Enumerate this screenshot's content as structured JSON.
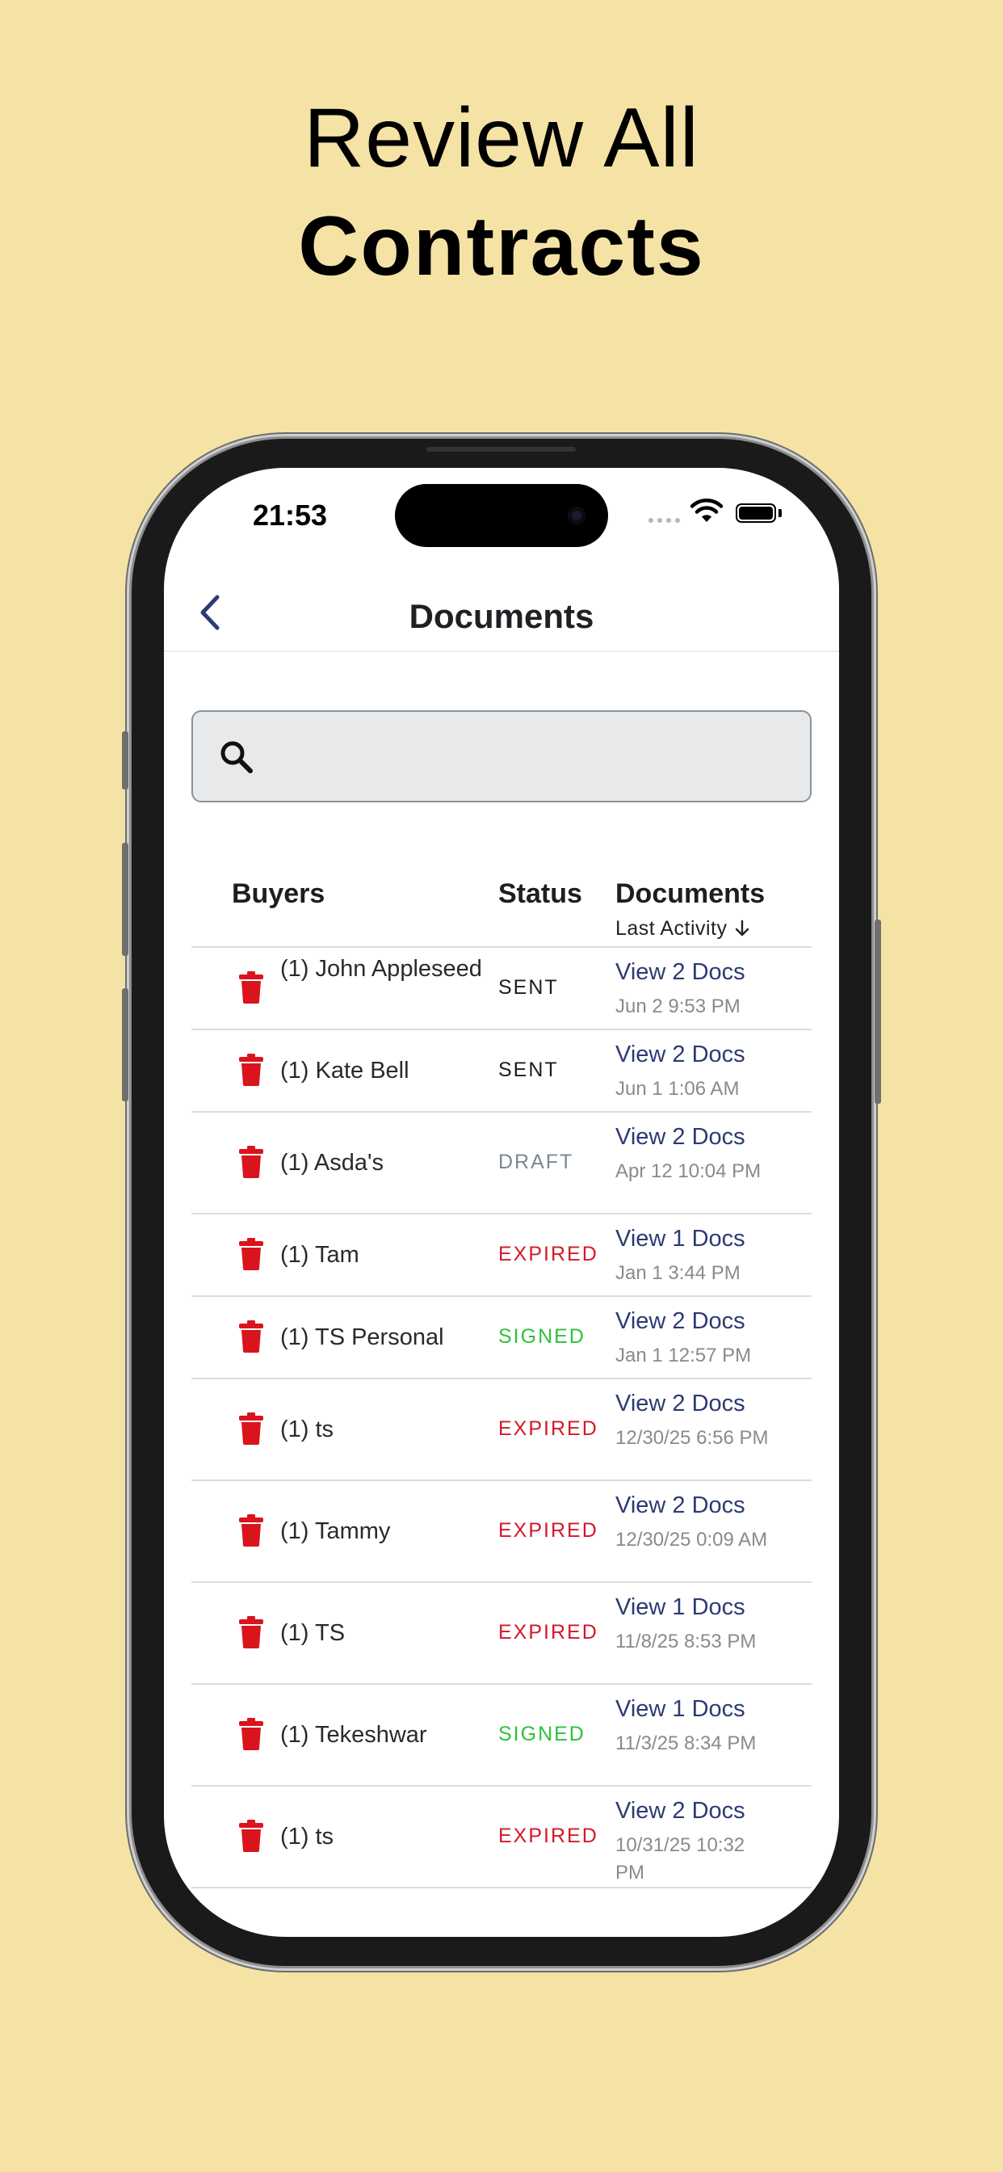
{
  "headline": {
    "line1": "Review All",
    "line2": "Contracts"
  },
  "status_bar": {
    "time": "21:53"
  },
  "nav": {
    "title": "Documents"
  },
  "search": {
    "placeholder": "",
    "value": ""
  },
  "table": {
    "headers": {
      "buyers": "Buyers",
      "status": "Status",
      "documents": "Documents",
      "sort_label": "Last Activity"
    },
    "rows": [
      {
        "buyer": "(1) John Appleseed",
        "status": "SENT",
        "docs": "View 2 Docs",
        "date": "Jun 2 9:53 PM"
      },
      {
        "buyer": "(1) Kate Bell",
        "status": "SENT",
        "docs": "View 2 Docs",
        "date": "Jun 1 1:06 AM"
      },
      {
        "buyer": "(1) Asda's",
        "status": "DRAFT",
        "docs": "View 2 Docs",
        "date": "Apr 12 10:04 PM"
      },
      {
        "buyer": "(1) Tam",
        "status": "EXPIRED",
        "docs": "View 1 Docs",
        "date": "Jan 1 3:44 PM"
      },
      {
        "buyer": "(1) TS Personal",
        "status": "SIGNED",
        "docs": "View 2 Docs",
        "date": "Jan 1 12:57 PM"
      },
      {
        "buyer": "(1) ts",
        "status": "EXPIRED",
        "docs": "View 2 Docs",
        "date": "12/30/25 6:56 PM"
      },
      {
        "buyer": "(1) Tammy",
        "status": "EXPIRED",
        "docs": "View 2 Docs",
        "date": "12/30/25 0:09 AM"
      },
      {
        "buyer": "(1) TS",
        "status": "EXPIRED",
        "docs": "View 1 Docs",
        "date": "11/8/25 8:53 PM"
      },
      {
        "buyer": "(1) Tekeshwar",
        "status": "SIGNED",
        "docs": "View 1 Docs",
        "date": "11/3/25 8:34 PM"
      },
      {
        "buyer": "(1) ts",
        "status": "EXPIRED",
        "docs": "View 2 Docs",
        "date": "10/31/25 10:32 PM"
      }
    ]
  },
  "colors": {
    "background": "#f5e3a6",
    "trash": "#d9141c",
    "sent": "#1d1d1d",
    "draft": "#7b8794",
    "expired": "#d3182a",
    "signed": "#2dc23b",
    "link": "#2d3a73"
  },
  "icons": {
    "back": "chevron-left-icon",
    "search": "search-icon",
    "trash": "trash-icon",
    "sort": "arrow-down-icon",
    "wifi": "wifi-icon",
    "battery": "battery-icon"
  }
}
